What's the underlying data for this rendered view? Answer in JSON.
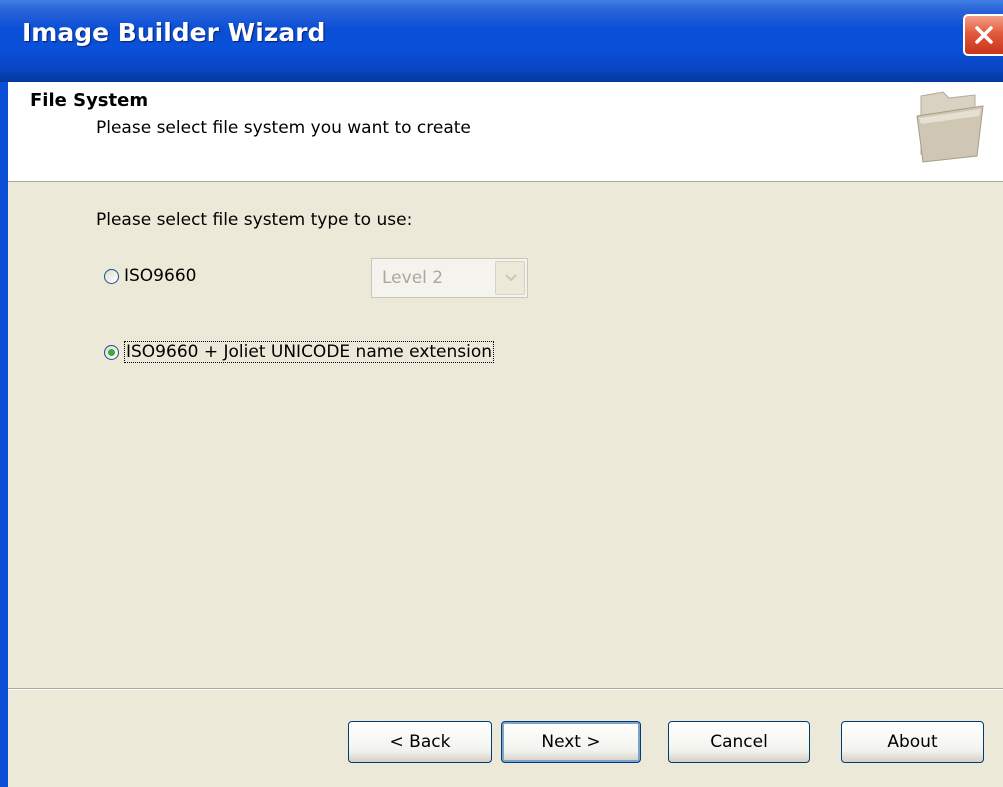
{
  "window": {
    "title": "Image Builder Wizard"
  },
  "header": {
    "title": "File System",
    "subtitle": "Please select file system you want to create"
  },
  "content": {
    "prompt": "Please select file system type to use:",
    "options": [
      {
        "label": "ISO9660",
        "checked": false
      },
      {
        "label": "ISO9660 + Joliet UNICODE name extension",
        "checked": true
      }
    ],
    "level_select": {
      "value": "Level 2",
      "enabled": false
    }
  },
  "buttons": {
    "back": "< Back",
    "next": "Next >",
    "cancel": "Cancel",
    "about": "About"
  },
  "icons": [
    "close-icon",
    "folder-icon",
    "chevron-down-icon"
  ]
}
